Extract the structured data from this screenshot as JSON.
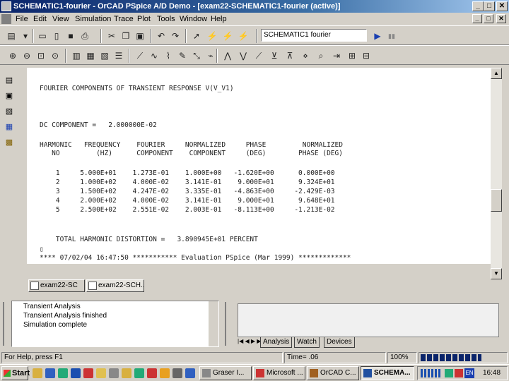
{
  "window": {
    "title": "SCHEMATIC1-fourier - OrCAD PSpice A/D Demo - [exam22-SCHEMATIC1-fourier (active)]",
    "min": "_",
    "max": "□",
    "close": "✕"
  },
  "menu": [
    "File",
    "Edit",
    "View",
    "Simulation",
    "Trace",
    "Plot",
    "Tools",
    "Window",
    "Help"
  ],
  "toolbar": {
    "profile": "SCHEMATIC1 fourier",
    "run_icon": "▶",
    "pause_icon": "▮▮"
  },
  "output": {
    "heading": "FOURIER COMPONENTS OF TRANSIENT RESPONSE V(V_V1)",
    "dc_line": "DC COMPONENT =   2.000000E-02",
    "header1": "HARMONIC   FREQUENCY    FOURIER     NORMALIZED     PHASE         NORMALIZED",
    "header2": "   NO         (HZ)      COMPONENT    COMPONENT     (DEG)        PHASE (DEG)",
    "rows": [
      "    1     5.000E+01    1.273E-01    1.000E+00   -1.620E+00      0.000E+00",
      "    2     1.000E+02    4.000E-02    3.141E-01    9.000E+01      9.324E+01",
      "    3     1.500E+02    4.247E-02    3.335E-01   -4.863E+00     -2.429E-03",
      "    4     2.000E+02    4.000E-02    3.141E-01    9.000E+01      9.648E+01",
      "    5     2.500E+02    2.551E-02    2.003E-01   -8.113E+00     -1.213E-02"
    ],
    "thd": "    TOTAL HARMONIC DISTORTION =   3.890945E+01 PERCENT",
    "cursor": "▯",
    "footer": "**** 07/02/04 16:47:50 *********** Evaluation PSpice (Mar 1999) *************"
  },
  "tabs": [
    "exam22-SC",
    "exam22-SCH..."
  ],
  "sim_messages": [
    "Transient Analysis",
    "Transient Analysis finished",
    "Simulation complete"
  ],
  "bottom_tabs": [
    "Analysis",
    "Watch",
    "Devices"
  ],
  "status": {
    "help": "For Help, press F1",
    "time": "Time= .06",
    "zoom": "100%"
  },
  "taskbar": {
    "start": "Start",
    "tasks": [
      "Graser I...",
      "Microsoft ...",
      "OrCAD C...",
      "SCHEMA..."
    ],
    "lang": "EN",
    "clock": "16:48"
  }
}
